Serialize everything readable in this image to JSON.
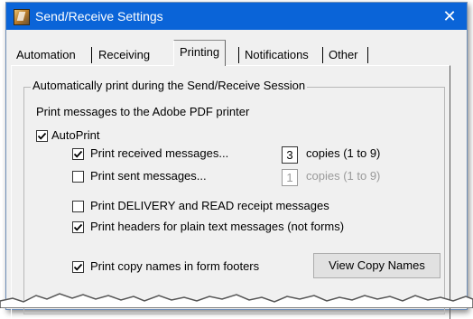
{
  "window": {
    "title": "Send/Receive Settings",
    "close_glyph": "✕",
    "title_bar_color": "#0a64d8",
    "icon": "app-icon"
  },
  "tabs": [
    {
      "label": "Automation",
      "active": false
    },
    {
      "label": "Receiving",
      "active": false
    },
    {
      "label": "Printing",
      "active": true
    },
    {
      "label": "Notifications",
      "active": false
    },
    {
      "label": "Other",
      "active": false
    }
  ],
  "group": {
    "legend": "Automatically print during the Send/Receive Session",
    "printer_line": "Print messages to the Adobe PDF printer",
    "autoprint": {
      "label": "AutoPrint",
      "checked": true
    },
    "received": {
      "label": "Print received messages...",
      "checked": true,
      "copies": "3",
      "copies_label": "copies (1 to 9)"
    },
    "sent": {
      "label": "Print sent messages...",
      "checked": false,
      "copies": "1",
      "copies_label": "copies (1 to 9)",
      "disabled": true
    },
    "receipts": {
      "label": "Print DELIVERY and READ receipt messages",
      "checked": false
    },
    "headers": {
      "label": "Print headers for plain text messages (not forms)",
      "checked": true
    },
    "copy_names": {
      "label": "Print copy names in form footers",
      "checked": true
    },
    "view_copy_names_button": "View Copy Names"
  }
}
